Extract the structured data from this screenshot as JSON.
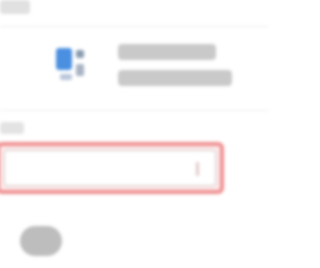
{
  "theme": {
    "highlight_color": "#ef8f8f",
    "logo_blue": "#4a8fe0",
    "logo_dark": "#8a9bb0"
  },
  "header": {
    "logo_icon": "app-logo-icon"
  },
  "form": {
    "input_value": "",
    "input_placeholder": ""
  },
  "actions": {
    "button_label": ""
  }
}
